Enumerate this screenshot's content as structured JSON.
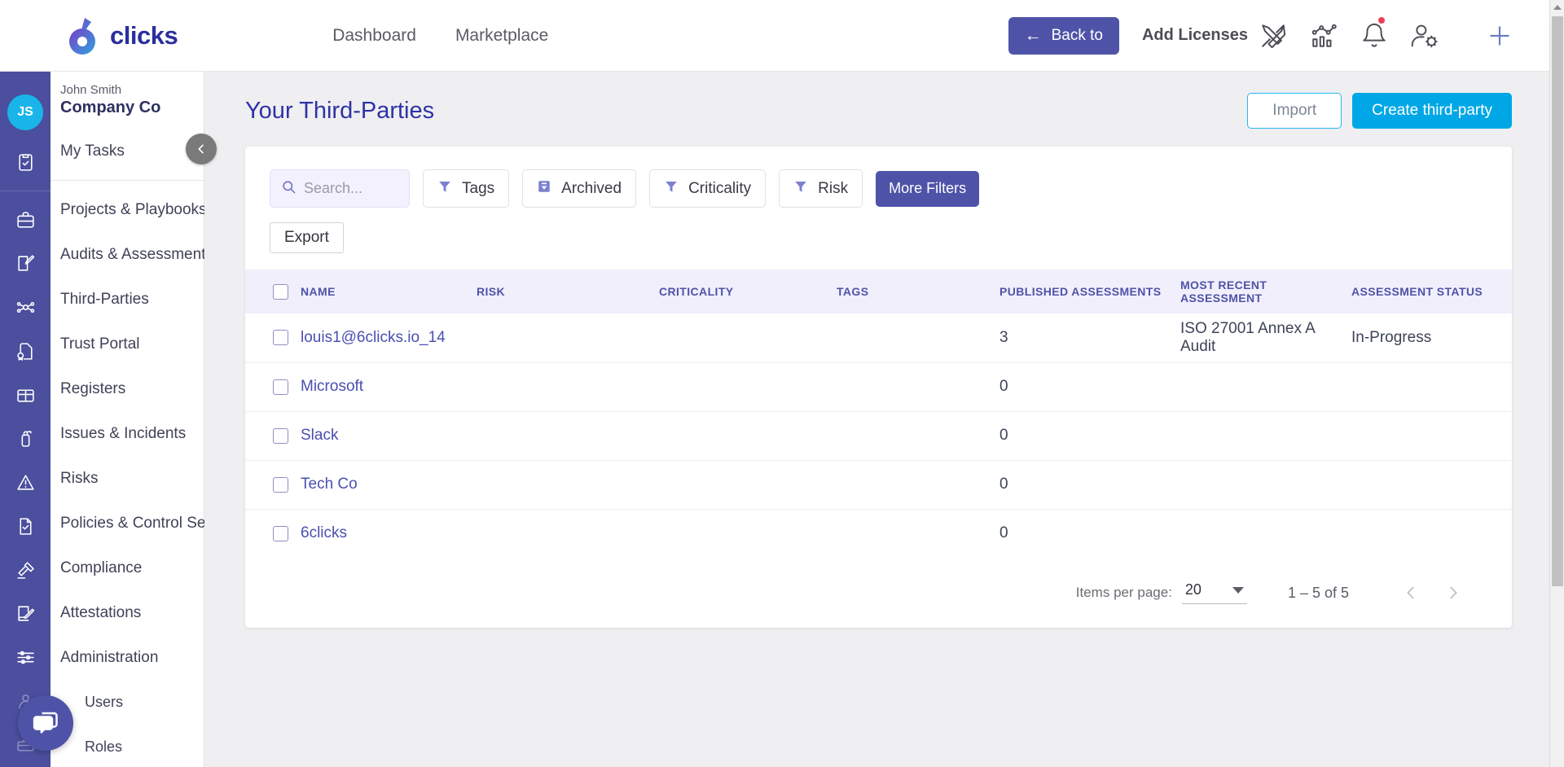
{
  "brand": {
    "logo_text": "clicks",
    "logo_icon": "six-clicks-logo"
  },
  "topnav": {
    "items": [
      {
        "label": "Dashboard"
      },
      {
        "label": "Marketplace"
      }
    ]
  },
  "topbar": {
    "back_button": "Back to",
    "add_licenses": "Add Licenses",
    "icons": [
      {
        "name": "design-tools-icon"
      },
      {
        "name": "analytics-icon"
      },
      {
        "name": "notifications-bell-icon",
        "badge": true
      },
      {
        "name": "user-settings-icon"
      },
      {
        "name": "add-plus-icon"
      }
    ]
  },
  "sidebar": {
    "user": {
      "initials": "JS",
      "name": "John Smith",
      "org": "Company Co"
    },
    "my_tasks": "My Tasks",
    "collapse_icon": "chevron-left-icon",
    "chat_icon": "chat-bubble-icon",
    "items": [
      {
        "label": "Projects & Playbooks",
        "icon": "briefcase-icon"
      },
      {
        "label": "Audits & Assessments",
        "icon": "edit-document-icon"
      },
      {
        "label": "Third-Parties",
        "icon": "network-nodes-icon"
      },
      {
        "label": "Trust Portal",
        "icon": "certificate-icon"
      },
      {
        "label": "Registers",
        "icon": "box-icon"
      },
      {
        "label": "Issues & Incidents",
        "icon": "fire-extinguisher-icon"
      },
      {
        "label": "Risks",
        "icon": "warning-triangle-icon"
      },
      {
        "label": "Policies & Control Sets",
        "icon": "policy-document-icon"
      },
      {
        "label": "Compliance",
        "icon": "gavel-icon"
      },
      {
        "label": "Attestations",
        "icon": "signature-icon"
      },
      {
        "label": "Administration",
        "icon": "sliders-icon"
      }
    ],
    "sub_items": [
      {
        "label": "Users",
        "icon": "users-icon"
      },
      {
        "label": "Roles",
        "icon": "roles-icon"
      }
    ]
  },
  "page": {
    "title": "Your Third-Parties",
    "import_label": "Import",
    "create_label": "Create third-party"
  },
  "filters": {
    "search_placeholder": "Search...",
    "search_value": "",
    "search_icon": "search-icon",
    "chips": [
      {
        "label": "Tags",
        "icon": "funnel-icon"
      },
      {
        "label": "Archived",
        "icon": "archive-box-icon"
      },
      {
        "label": "Criticality",
        "icon": "funnel-icon"
      },
      {
        "label": "Risk",
        "icon": "funnel-icon"
      }
    ],
    "more_filters_label": "More Filters",
    "export_label": "Export"
  },
  "table": {
    "columns": [
      "NAME",
      "RISK",
      "CRITICALITY",
      "TAGS",
      "PUBLISHED ASSESSMENTS",
      "MOST RECENT ASSESSMENT",
      "ASSESSMENT STATUS"
    ],
    "rows": [
      {
        "name": "louis1@6clicks.io_14",
        "risk": "",
        "criticality": "",
        "tags": "",
        "published": "3",
        "recent": "ISO 27001 Annex A Audit",
        "status": "In-Progress"
      },
      {
        "name": "Microsoft",
        "risk": "",
        "criticality": "",
        "tags": "",
        "published": "0",
        "recent": "",
        "status": ""
      },
      {
        "name": "Slack",
        "risk": "",
        "criticality": "",
        "tags": "",
        "published": "0",
        "recent": "",
        "status": ""
      },
      {
        "name": "Tech Co",
        "risk": "",
        "criticality": "",
        "tags": "",
        "published": "0",
        "recent": "",
        "status": ""
      },
      {
        "name": "6clicks",
        "risk": "",
        "criticality": "",
        "tags": "",
        "published": "0",
        "recent": "",
        "status": ""
      }
    ]
  },
  "pagination": {
    "items_per_page_label": "Items per page:",
    "items_per_page_value": "20",
    "range": "1 – 5 of 5",
    "prev_icon": "chevron-left-icon",
    "next_icon": "chevron-right-icon"
  },
  "colors": {
    "brand_purple": "#4f53a8",
    "brand_cyan": "#00a7e6",
    "avatar_cyan": "#19b5e8",
    "title_indigo": "#2f32a6",
    "status_blue": "#5d86c4",
    "notification_red": "#ef3e56"
  }
}
